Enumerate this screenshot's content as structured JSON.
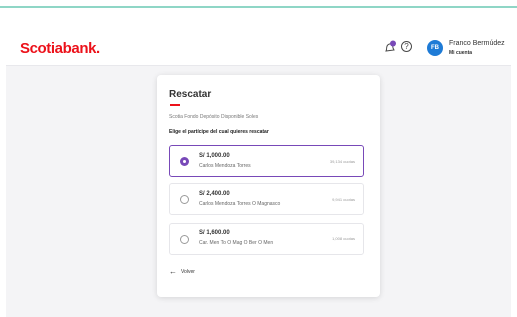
{
  "header": {
    "logo": "Scotiabank.",
    "user_initials": "FB",
    "user_name": "Franco Bermúdez",
    "user_role": "Mi cuenta"
  },
  "card": {
    "title": "Rescatar",
    "subtitle": "Scotia Fondo Depósito Disponible Soles",
    "prompt": "Elige el partícipe del cual quieres rescatar",
    "options": [
      {
        "amount": "S/ 1,000.00",
        "name": "Carlos Mendoza Torres",
        "units": "39,134 cuotas",
        "selected": true
      },
      {
        "amount": "S/ 2,400.00",
        "name": "Carlos Mendoza Torres O Magnasco",
        "units": "9,941 cuotas",
        "selected": false
      },
      {
        "amount": "S/ 1,600.00",
        "name": "Car. Men To O Mag O Ber O Men",
        "units": "1,008 cuotas",
        "selected": false
      }
    ],
    "back_label": "Volver"
  },
  "colors": {
    "brand": "#ec111a",
    "accent": "#7849b8",
    "avatar": "#1e7bd6"
  },
  "icons": {
    "notifications": "bell-icon",
    "help": "help-icon",
    "back": "arrow-left-icon"
  }
}
